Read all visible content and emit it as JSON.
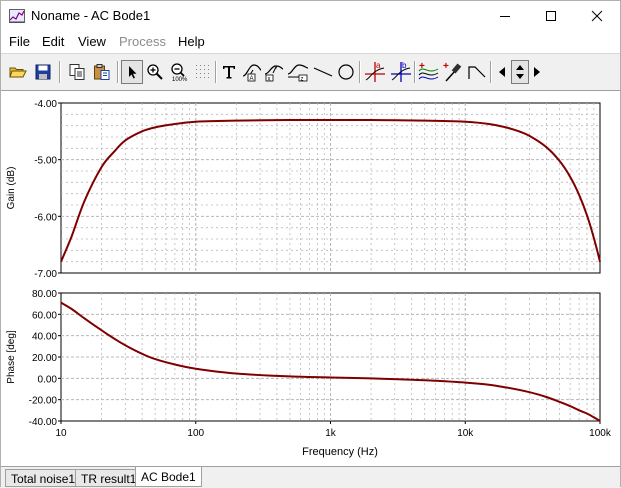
{
  "window": {
    "title": "Noname - AC Bode1",
    "minimize_icon": "minimize-icon",
    "maximize_icon": "maximize-icon",
    "close_icon": "close-icon"
  },
  "menu": {
    "file": "File",
    "edit": "Edit",
    "view": "View",
    "process": "Process",
    "help": "Help"
  },
  "toolbar": {
    "icons": [
      "open-folder-icon",
      "save-icon",
      "copy-icon",
      "paste-icon",
      "pointer-icon",
      "zoom-in-icon",
      "zoom-100-icon",
      "grid-select-icon",
      "text-icon",
      "curve-label-icon",
      "curve-label-2-icon",
      "curve-marker-icon",
      "line-icon",
      "ellipse-icon",
      "cursor-a-icon",
      "cursor-b-icon",
      "add-curve-icon",
      "add-probe-icon",
      "tangent-icon",
      "arrow-left-icon",
      "arrow-up-down-icon",
      "arrow-right-icon"
    ],
    "accent_red": "#c00000",
    "accent_blue": "#0000c0"
  },
  "tabs": [
    {
      "label": "Total noise1",
      "active": false
    },
    {
      "label": "TR result1",
      "active": false
    },
    {
      "label": "AC Bode1",
      "active": true
    }
  ],
  "chart_data": [
    {
      "type": "line",
      "ylabel": "Gain (dB)",
      "xscale": "log",
      "xlim": [
        10,
        100000
      ],
      "ylim": [
        -7.0,
        -4.0
      ],
      "yticks": [
        "-4.00",
        "-5.00",
        "-6.00",
        "-7.00"
      ],
      "grid": true,
      "color": "#800000",
      "series": [
        {
          "x": [
            10,
            12,
            15,
            20,
            25,
            30,
            40,
            50,
            70,
            100,
            200,
            500,
            1000,
            2000,
            5000,
            10000,
            15000,
            20000,
            25000,
            30000,
            40000,
            50000,
            60000,
            70000,
            80000,
            90000,
            100000
          ],
          "y": [
            -6.8,
            -6.35,
            -5.72,
            -5.13,
            -4.85,
            -4.66,
            -4.5,
            -4.43,
            -4.37,
            -4.33,
            -4.31,
            -4.3,
            -4.3,
            -4.3,
            -4.31,
            -4.33,
            -4.37,
            -4.43,
            -4.5,
            -4.58,
            -4.78,
            -5.02,
            -5.3,
            -5.62,
            -5.98,
            -6.38,
            -6.8
          ]
        }
      ]
    },
    {
      "type": "line",
      "xlabel": "Frequency (Hz)",
      "ylabel": "Phase [deg]",
      "xscale": "log",
      "xlim": [
        10,
        100000
      ],
      "ylim": [
        -40,
        80
      ],
      "yticks": [
        "80.00",
        "60.00",
        "40.00",
        "20.00",
        "0.00",
        "-20.00",
        "-40.00"
      ],
      "xticks": [
        "10",
        "100",
        "1k",
        "10k",
        "100k"
      ],
      "grid": true,
      "color": "#800000",
      "series": [
        {
          "x": [
            10,
            12,
            15,
            20,
            25,
            30,
            40,
            50,
            70,
            100,
            200,
            500,
            1000,
            2000,
            5000,
            10000,
            15000,
            20000,
            30000,
            40000,
            50000,
            60000,
            70000,
            80000,
            90000,
            100000
          ],
          "y": [
            71,
            65,
            56,
            45,
            37,
            31,
            23,
            18,
            13,
            9,
            4.5,
            1.8,
            0.8,
            -0.1,
            -1.8,
            -4,
            -6,
            -8.5,
            -13,
            -17.5,
            -22,
            -26,
            -30,
            -33,
            -36.5,
            -40
          ]
        }
      ]
    }
  ]
}
